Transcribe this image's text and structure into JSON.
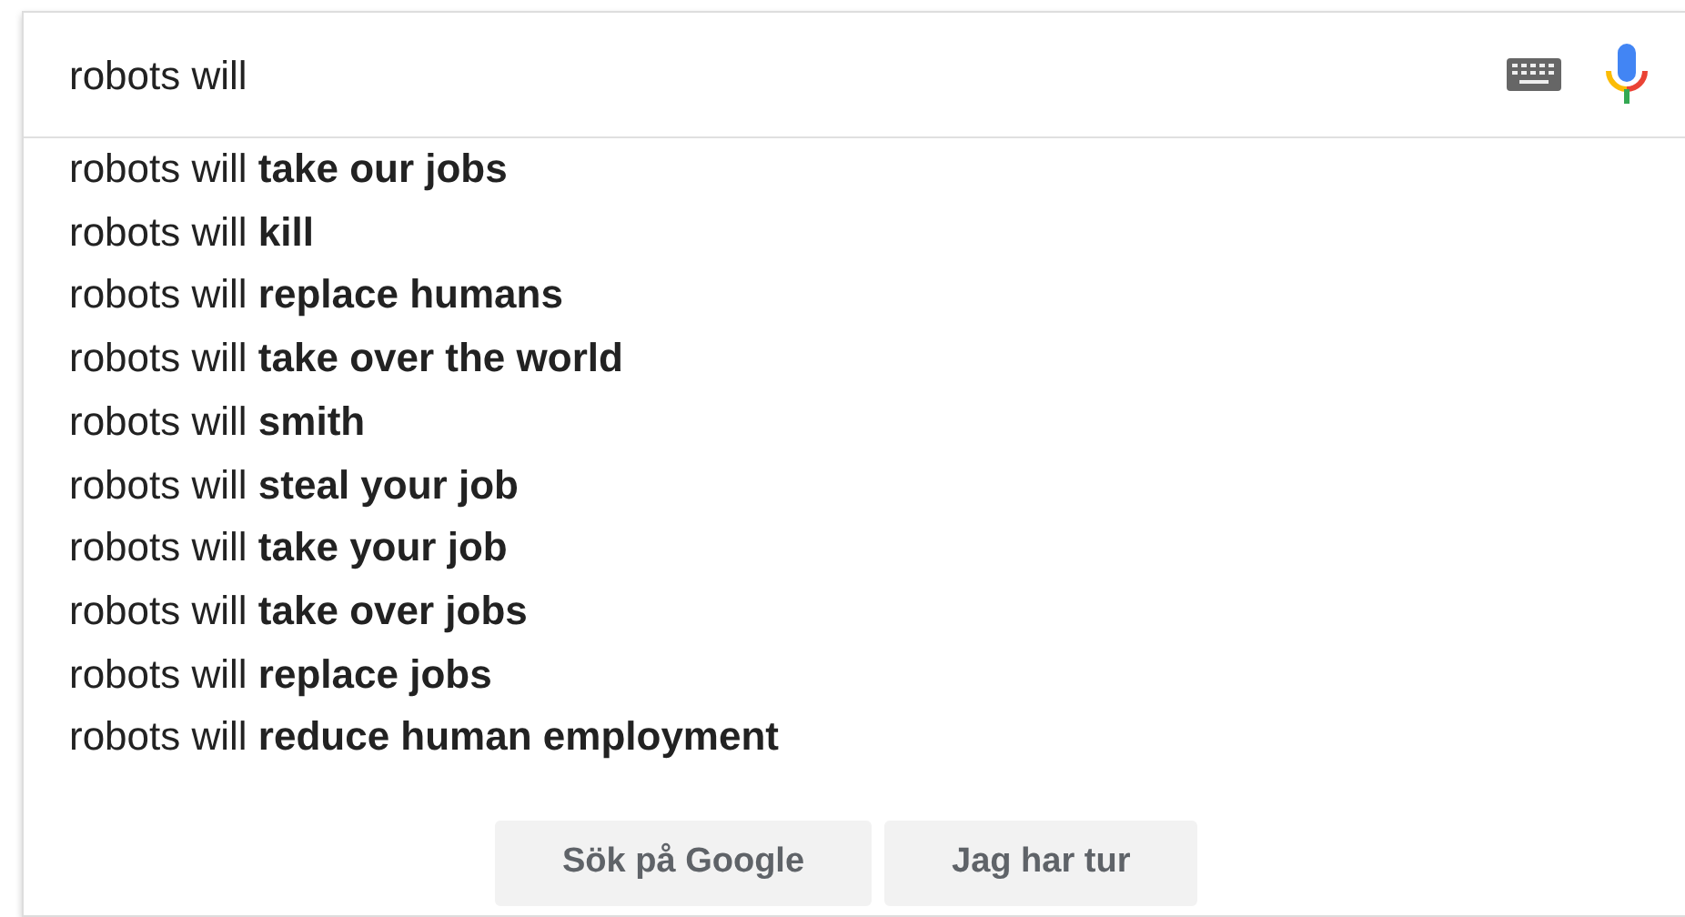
{
  "search": {
    "value": "robots will"
  },
  "suggestions": [
    "robots will **take our jobs**",
    "robots will **kill**",
    "robots will **replace humans**",
    "robots will **take over the world**",
    "robots will **smith**",
    "robots will **steal your job**",
    "robots will **take your job**",
    "robots will **take over jobs**",
    "robots will **replace jobs**",
    "robots will **reduce human employment**"
  ],
  "buttons": [
    "Sök på Google",
    "Jag har tur"
  ]
}
